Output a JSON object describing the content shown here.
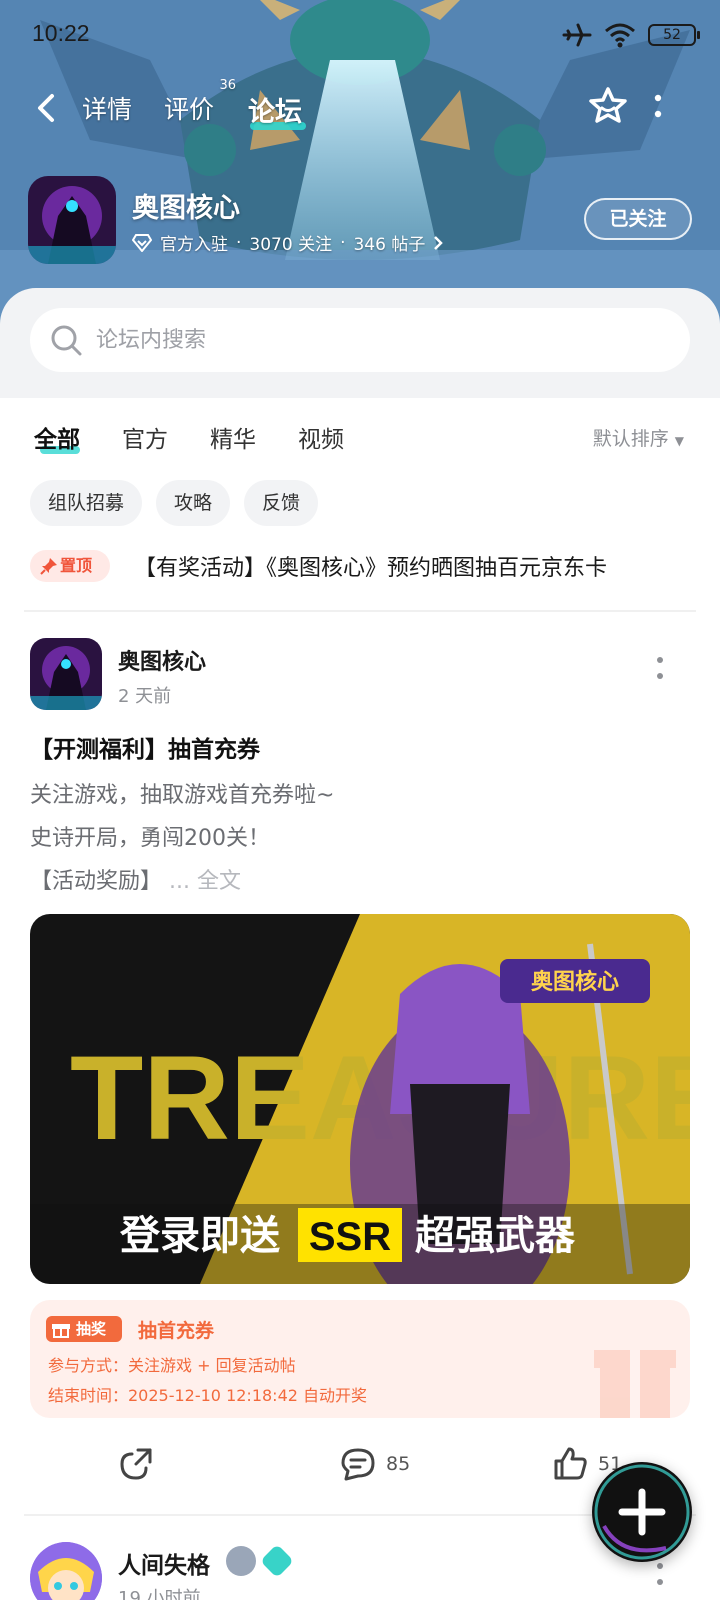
{
  "status_bar": {
    "time": "10:22",
    "battery": "52"
  },
  "nav": {
    "tabs": [
      {
        "label": "详情"
      },
      {
        "label": "评价",
        "badge": "36"
      },
      {
        "label": "论坛"
      }
    ]
  },
  "game": {
    "name": "奥图核心",
    "verified_label": "官方入驻",
    "followers": "3070 关注",
    "posts": "346 帖子",
    "follow_button": "已关注"
  },
  "search": {
    "placeholder": "论坛内搜索"
  },
  "filter_tabs": [
    "全部",
    "官方",
    "精华",
    "视频"
  ],
  "sort_label": "默认排序",
  "chips": [
    "组队招募",
    "攻略",
    "反馈"
  ],
  "pinned": {
    "badge": "置顶",
    "title": "【有奖活动】《奥图核心》预约晒图抽百元京东卡"
  },
  "post": {
    "author": "奥图核心",
    "time": "2 天前",
    "title": "【开测福利】抽首充券",
    "body_lines": [
      "关注游戏，抽取游戏首充券啦~",
      "史诗开局，勇闯200关！",
      "【活动奖励】"
    ],
    "read_more": "... 全文",
    "banner": {
      "logo_text": "奥图核心",
      "big_word": "TREASURE",
      "caption_before": "登录即送",
      "caption_highlight": "SSR",
      "caption_after": "超强武器"
    },
    "lottery": {
      "tag": "抽奖",
      "title": "抽首充券",
      "method": "参与方式：关注游戏 + 回复活动帖",
      "end_time": "结束时间：2025-12-10 12:18:42 自动开奖"
    },
    "comments": "85",
    "likes": "51"
  },
  "next_post": {
    "author": "人间失格",
    "time": "19 小时前"
  },
  "colors": {
    "accent": "#2fd6cf",
    "orange": "#f26a3d",
    "pin_red": "#f0553b",
    "text_gray": "#8e9095"
  }
}
